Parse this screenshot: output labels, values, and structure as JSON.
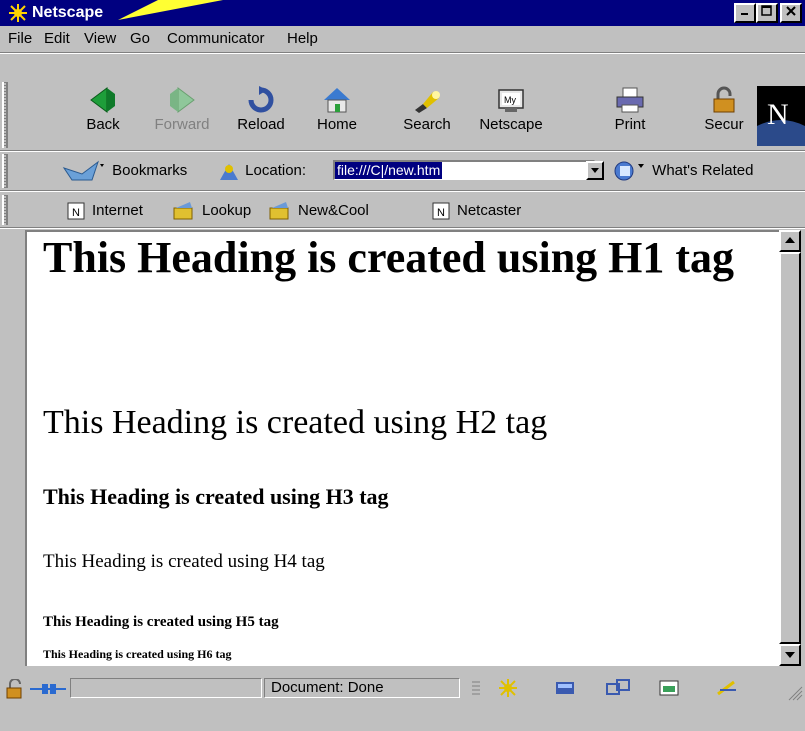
{
  "window": {
    "title": "Netscape"
  },
  "menu": [
    {
      "label": "File"
    },
    {
      "label": "Edit"
    },
    {
      "label": "View"
    },
    {
      "label": "Go"
    },
    {
      "label": "Communicator"
    },
    {
      "label": "Help"
    }
  ],
  "nav_toolbar": {
    "back": "Back",
    "forward": "Forward",
    "reload": "Reload",
    "home": "Home",
    "search": "Search",
    "netscape": "Netscape",
    "print": "Print",
    "security": "Secur"
  },
  "location_bar": {
    "bookmarks_label": "Bookmarks",
    "location_label": "Location:",
    "url": "file:///C|/new.htm",
    "whats_related": "What's Related"
  },
  "personal_toolbar": {
    "items": [
      "Internet",
      "Lookup",
      "New&Cool",
      "Netcaster"
    ]
  },
  "document": {
    "h1": "This Heading is created using H1 tag",
    "h2": "This Heading is created using H2 tag",
    "h3": "This Heading is created using H3 tag",
    "h4": "This Heading is created using H4 tag",
    "h5": "This Heading is created using H5 tag",
    "h6": "This Heading is created using H6 tag"
  },
  "status": {
    "text": "Document: Done"
  },
  "colors": {
    "title_bar": "#000080",
    "chrome": "#c0c0c0",
    "selection": "#000080"
  }
}
